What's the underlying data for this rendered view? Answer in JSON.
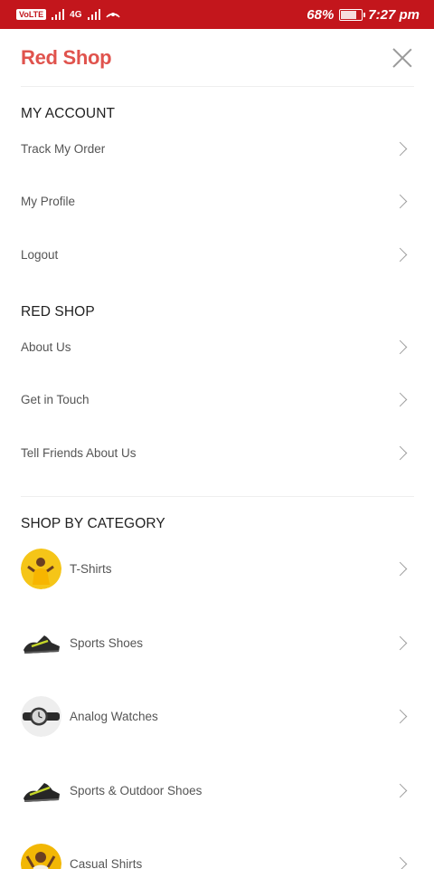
{
  "status_bar": {
    "volte": "VoLTE",
    "network": "4G",
    "battery_percent": "68%",
    "battery_level": 0.68,
    "time": "7:27 pm"
  },
  "header": {
    "brand": "Red Shop",
    "close_icon": "close-icon"
  },
  "my_account": {
    "title": "MY ACCOUNT",
    "items": [
      {
        "label": "Track My Order"
      },
      {
        "label": "My Profile"
      },
      {
        "label": "Logout"
      }
    ]
  },
  "red_shop": {
    "title": "RED SHOP",
    "items": [
      {
        "label": "About Us"
      },
      {
        "label": "Get in Touch"
      },
      {
        "label": "Tell Friends About Us"
      }
    ]
  },
  "categories": {
    "title": "SHOP BY CATEGORY",
    "items": [
      {
        "label": "T-Shirts",
        "icon": "tshirt-person-icon"
      },
      {
        "label": "Sports Shoes",
        "icon": "sports-shoe-icon"
      },
      {
        "label": "Analog Watches",
        "icon": "watch-icon"
      },
      {
        "label": "Sports & Outdoor Shoes",
        "icon": "outdoor-shoe-icon"
      },
      {
        "label": "Casual Shirts",
        "icon": "casual-shirt-person-icon"
      }
    ]
  },
  "colors": {
    "status_bar": "#c3161c",
    "brand": "#e0534d"
  }
}
